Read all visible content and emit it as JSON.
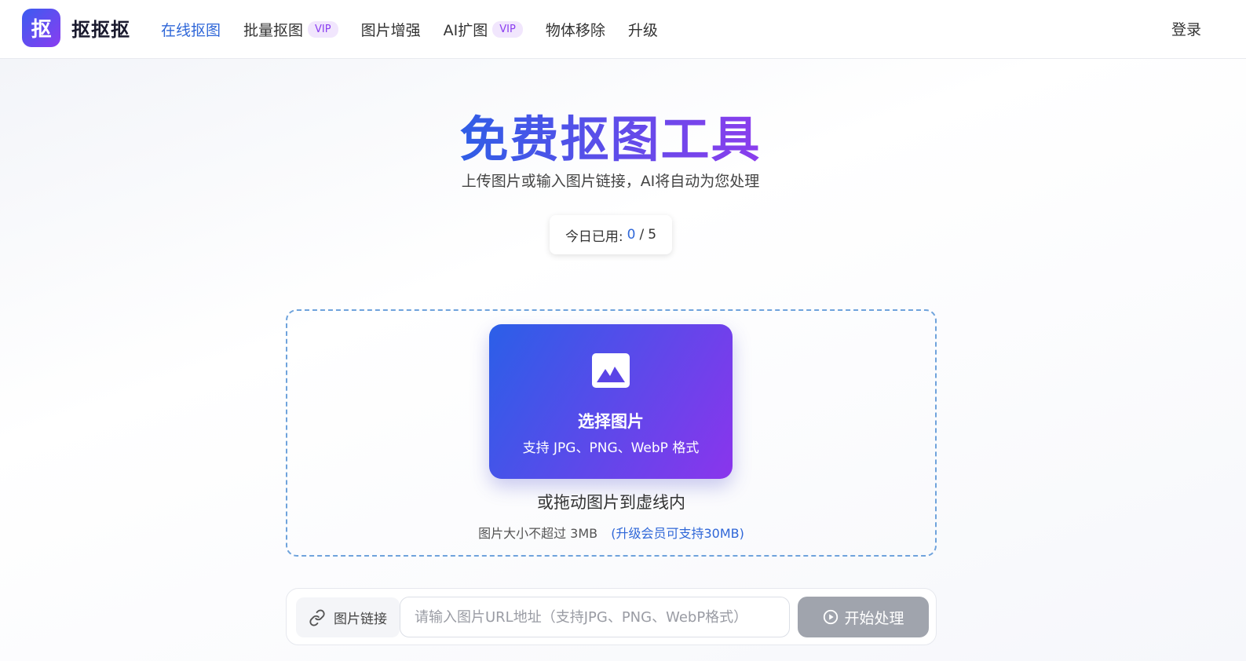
{
  "header": {
    "logo_char": "抠",
    "brand": "抠抠抠",
    "nav": [
      {
        "label": "在线抠图",
        "active": true,
        "vip": ""
      },
      {
        "label": "批量抠图",
        "active": false,
        "vip": "VIP"
      },
      {
        "label": "图片增强",
        "active": false,
        "vip": ""
      },
      {
        "label": "AI扩图",
        "active": false,
        "vip": "VIP"
      },
      {
        "label": "物体移除",
        "active": false,
        "vip": ""
      },
      {
        "label": "升级",
        "active": false,
        "vip": ""
      }
    ],
    "login": "登录"
  },
  "hero": {
    "title": "免费抠图工具",
    "subtitle": "上传图片或输入图片链接，AI将自动为您处理",
    "usage_label": "今日已用:",
    "usage_used": "0",
    "usage_sep": "/",
    "usage_limit": "5"
  },
  "upload": {
    "icon": "image-icon",
    "select_title": "选择图片",
    "select_hint": "支持 JPG、PNG、WebP 格式",
    "drag_text": "或拖动图片到虚线内",
    "size_limit": "图片大小不超过 3MB",
    "upgrade_link": "(升级会员可支持30MB)"
  },
  "url_bar": {
    "label": "图片链接",
    "placeholder": "请输入图片URL地址（支持JPG、PNG、WebP格式）",
    "value": "",
    "start_label": "开始处理"
  },
  "colors": {
    "accent": "#2f67d8",
    "gradient_start": "#2b5fe8",
    "gradient_end": "#8a35ec",
    "vip": "#8a3df0",
    "disabled_button": "#a0a4ad"
  }
}
